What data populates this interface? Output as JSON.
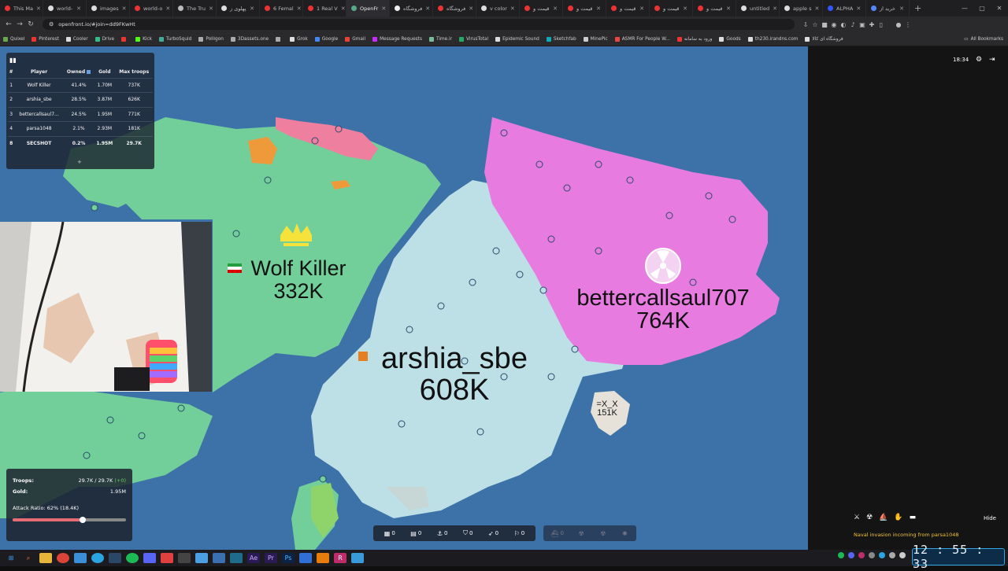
{
  "browser": {
    "tabs": [
      {
        "label": "This Ma",
        "color": "#e33"
      },
      {
        "label": "world-",
        "color": "#ddd"
      },
      {
        "label": "images",
        "color": "#ddd"
      },
      {
        "label": "world-o",
        "color": "#e33"
      },
      {
        "label": "The Tru",
        "color": "#bbb"
      },
      {
        "label": "پهلوی ز",
        "color": "#ddd"
      },
      {
        "label": "6 Femal",
        "color": "#e33"
      },
      {
        "label": "1 Real V",
        "color": "#e33"
      },
      {
        "label": "OpenFr",
        "color": "#5a8",
        "active": true
      },
      {
        "label": "فروشگاه",
        "color": "#eee"
      },
      {
        "label": "فروشگاه",
        "color": "#e33"
      },
      {
        "label": "v color",
        "color": "#ddd"
      },
      {
        "label": "قیمت و",
        "color": "#e33"
      },
      {
        "label": "قیمت و",
        "color": "#e33"
      },
      {
        "label": "قیمت و",
        "color": "#e33"
      },
      {
        "label": "قیمت و",
        "color": "#e33"
      },
      {
        "label": "قیمت و",
        "color": "#e33"
      },
      {
        "label": "untitled",
        "color": "#ddd"
      },
      {
        "label": "apple s",
        "color": "#ddd"
      },
      {
        "label": "ALPHA",
        "color": "#35f"
      },
      {
        "label": "خرید از",
        "color": "#58f"
      }
    ],
    "url": "openfront.io/#join=dd9FKwHt",
    "bookmarks": [
      "Quixel",
      "Pinterest",
      "Cooler",
      "Drive",
      "",
      "Kick",
      "TurboSquid",
      "Poliigon",
      "3Dassets.one",
      "",
      "Grok",
      "Google",
      "Gmail",
      "Message Requests",
      "Time.ir",
      "VirusTotal",
      "Epidemic Sound",
      "Sketchfab",
      "MinePic",
      "ASMR For People W...",
      "ورود به سامانه",
      "Goods",
      "th230.irandns.com",
      "فروشگاه ای کالا"
    ],
    "all_bookmarks": "All Bookmarks"
  },
  "leaderboard": {
    "headers": [
      "#",
      "Player",
      "Owned",
      "Gold",
      "Max troops"
    ],
    "rows": [
      {
        "rank": "1",
        "player": "Wolf Killer",
        "owned": "41.4%",
        "gold": "1.70M",
        "max": "737K"
      },
      {
        "rank": "2",
        "player": "arshia_sbe",
        "owned": "28.5%",
        "gold": "3.87M",
        "max": "626K"
      },
      {
        "rank": "3",
        "player": "bettercallsaul7...",
        "owned": "24.5%",
        "gold": "1.95M",
        "max": "771K"
      },
      {
        "rank": "4",
        "player": "parsa1048",
        "owned": "2.1%",
        "gold": "2.93M",
        "max": "181K"
      },
      {
        "rank": "8",
        "player": "SECSHOT",
        "owned": "0.2%",
        "gold": "1.95M",
        "max": "29.7K",
        "me": true
      }
    ],
    "more": "+"
  },
  "players": {
    "wolf": {
      "name": "Wolf Killer",
      "troops": "332K"
    },
    "arshia": {
      "name": "arshia_sbe",
      "troops": "608K"
    },
    "saul": {
      "name": "bettercallsaul707",
      "troops": "764K"
    },
    "xx": {
      "name": "=X_X",
      "troops": "151K"
    }
  },
  "status": {
    "troops_label": "Troops:",
    "troops_value": "29.7K / 29.7K",
    "troops_gain": "(+0)",
    "gold_label": "Gold:",
    "gold_value": "1.95M",
    "ratio_text": "Attack Ratio: 62% (18.4K)",
    "ratio": 0.62
  },
  "build": {
    "items": [
      {
        "icon": "city-icon",
        "glyph": "▦",
        "count": "0"
      },
      {
        "icon": "factory-icon",
        "glyph": "▤",
        "count": "0"
      },
      {
        "icon": "port-icon",
        "glyph": "⚓",
        "count": "0"
      },
      {
        "icon": "defense-icon",
        "glyph": "⛉",
        "count": "0"
      },
      {
        "icon": "missile-icon",
        "glyph": "➶",
        "count": "0"
      },
      {
        "icon": "sam-icon",
        "glyph": "⚐",
        "count": "0"
      }
    ],
    "dim_items": [
      {
        "icon": "warship-icon",
        "glyph": "⛴",
        "count": "0"
      },
      {
        "icon": "atom-bomb-icon",
        "glyph": "☢",
        "count": ""
      },
      {
        "icon": "hydrogen-bomb-icon",
        "glyph": "☢",
        "count": ""
      },
      {
        "icon": "mirv-icon",
        "glyph": "✺",
        "count": ""
      }
    ]
  },
  "side": {
    "timer": "18:34",
    "hide": "Hide",
    "event": "Naval invasion incoming from parsa1048"
  },
  "clock": "12 : 55 : 33",
  "colors": {
    "ocean": "#3d72a8",
    "wolf": "#6fcf97",
    "arshia": "#b9dfe6",
    "saul": "#e67ae0",
    "event": "#f1c232"
  }
}
